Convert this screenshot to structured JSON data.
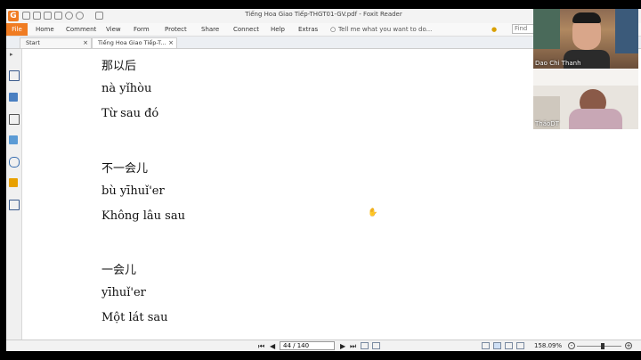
{
  "window": {
    "title": "Tiếng Hoa Giao Tiếp-THGT01-GV.pdf - Foxit Reader"
  },
  "menu": {
    "file": "File",
    "items": [
      "Home",
      "Comment",
      "View",
      "Form",
      "Protect",
      "Share",
      "Connect",
      "Help",
      "Extras"
    ],
    "tell_me": "Tell me what you want to do...",
    "find_placeholder": "Find"
  },
  "tabs": [
    {
      "label": "Start",
      "close": "×"
    },
    {
      "label": "Tiếng Hoa Giao Tiếp-T...",
      "close": "×"
    }
  ],
  "document": {
    "lines": [
      "那以后",
      "nà yǐhòu",
      "Từ sau đó",
      "不一会儿",
      "bù yīhuǐ'er",
      "Không lâu sau",
      "一会儿",
      "yīhuǐ'er",
      "Một lát sau"
    ]
  },
  "statusbar": {
    "page": "44 / 140",
    "zoom": "158.09%"
  },
  "video": {
    "participant1": "Dao Chi Thanh",
    "participant2": "ThảoDT"
  },
  "colors": {
    "accent": "#f07c22",
    "page_bg": "#ffffff",
    "frame_bg": "#000000"
  }
}
